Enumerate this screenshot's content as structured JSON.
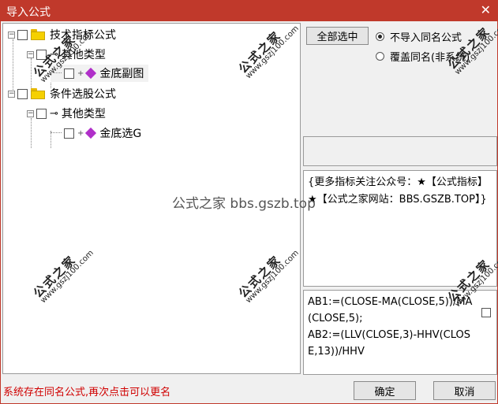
{
  "window": {
    "title": "导入公式",
    "close_glyph": "✕"
  },
  "tree": {
    "items": [
      {
        "label": "技术指标公式"
      },
      {
        "label": "其他类型"
      },
      {
        "label": "金底副图"
      },
      {
        "label": "条件选股公式"
      },
      {
        "label": "其他类型"
      },
      {
        "label": "金底选G"
      }
    ]
  },
  "controls": {
    "select_all": "全部选中",
    "radio_skip": "不导入同名公式",
    "radio_overwrite": "覆盖同名(非系统)"
  },
  "info": {
    "text": "{更多指标关注公众号：★【公式指标】★【公式之家网站：BBS.GSZB.TOP】}"
  },
  "code": {
    "text": "AB1:=(CLOSE-MA(CLOSE,5))/MA(CLOSE,5);\nAB2:=(LLV(CLOSE,3)-HHV(CLOSE,13))/HHV"
  },
  "footer": {
    "status": "系统存在同名公式,再次点击可以更名",
    "ok": "确定",
    "cancel": "取消"
  },
  "watermark": {
    "center": "公式之家 bbs.gszb.top",
    "title": "公式之家",
    "url": "www.gszj100.com"
  }
}
